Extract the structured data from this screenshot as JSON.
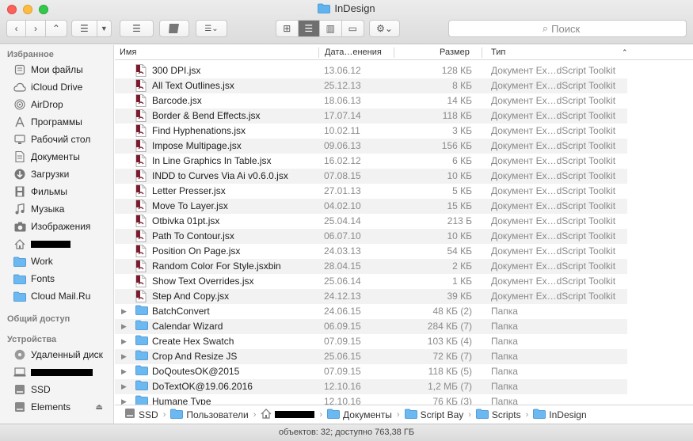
{
  "window": {
    "title": "InDesign"
  },
  "toolbar": {
    "search_placeholder": "Поиск"
  },
  "sidebar": {
    "favorites_label": "Избранное",
    "favorites": [
      {
        "label": "Мои файлы",
        "icon": "all-files-icon"
      },
      {
        "label": "iCloud Drive",
        "icon": "cloud-icon"
      },
      {
        "label": "AirDrop",
        "icon": "airdrop-icon"
      },
      {
        "label": "Программы",
        "icon": "applications-icon"
      },
      {
        "label": "Рабочий стол",
        "icon": "desktop-icon"
      },
      {
        "label": "Документы",
        "icon": "documents-icon"
      },
      {
        "label": "Загрузки",
        "icon": "downloads-icon"
      },
      {
        "label": "Фильмы",
        "icon": "movies-icon"
      },
      {
        "label": "Музыка",
        "icon": "music-icon"
      },
      {
        "label": "Изображения",
        "icon": "pictures-icon"
      },
      {
        "label": "",
        "icon": "home-icon"
      },
      {
        "label": "Work",
        "icon": "folder-icon"
      },
      {
        "label": "Fonts",
        "icon": "folder-icon"
      },
      {
        "label": "Cloud Mail.Ru",
        "icon": "folder-icon"
      }
    ],
    "shared_label": "Общий доступ",
    "devices_label": "Устройства",
    "devices": [
      {
        "label": "Удаленный диск",
        "icon": "optical-disc-icon"
      },
      {
        "label": "",
        "icon": "computer-icon"
      },
      {
        "label": "SSD",
        "icon": "drive-icon"
      },
      {
        "label": "Elements",
        "icon": "drive-icon"
      }
    ]
  },
  "columns": {
    "name": "Имя",
    "date": "Дата…енения",
    "size": "Размер",
    "kind": "Тип"
  },
  "files": [
    {
      "name": "300 DPI.jsx",
      "date": "13.06.12",
      "size": "128 КБ",
      "kind": "Документ Ex…dScript Toolkit",
      "type": "script"
    },
    {
      "name": "All Text Outlines.jsx",
      "date": "25.12.13",
      "size": "8 КБ",
      "kind": "Документ Ex…dScript Toolkit",
      "type": "script"
    },
    {
      "name": "Barcode.jsx",
      "date": "18.06.13",
      "size": "14 КБ",
      "kind": "Документ Ex…dScript Toolkit",
      "type": "script"
    },
    {
      "name": "Border & Bend Effects.jsx",
      "date": "17.07.14",
      "size": "118 КБ",
      "kind": "Документ Ex…dScript Toolkit",
      "type": "script"
    },
    {
      "name": "Find Hyphenations.jsx",
      "date": "10.02.11",
      "size": "3 КБ",
      "kind": "Документ Ex…dScript Toolkit",
      "type": "script"
    },
    {
      "name": "Impose Multipage.jsx",
      "date": "09.06.13",
      "size": "156 КБ",
      "kind": "Документ Ex…dScript Toolkit",
      "type": "script"
    },
    {
      "name": "In Line Graphics In Table.jsx",
      "date": "16.02.12",
      "size": "6 КБ",
      "kind": "Документ Ex…dScript Toolkit",
      "type": "script"
    },
    {
      "name": "INDD to Curves Via Ai v0.6.0.jsx",
      "date": "07.08.15",
      "size": "10 КБ",
      "kind": "Документ Ex…dScript Toolkit",
      "type": "script"
    },
    {
      "name": "Letter Presser.jsx",
      "date": "27.01.13",
      "size": "5 КБ",
      "kind": "Документ Ex…dScript Toolkit",
      "type": "script"
    },
    {
      "name": "Move To Layer.jsx",
      "date": "04.02.10",
      "size": "15 КБ",
      "kind": "Документ Ex…dScript Toolkit",
      "type": "script"
    },
    {
      "name": "Otbivka 01pt.jsx",
      "date": "25.04.14",
      "size": "213 Б",
      "kind": "Документ Ex…dScript Toolkit",
      "type": "script"
    },
    {
      "name": "Path To Contour.jsx",
      "date": "06.07.10",
      "size": "10 КБ",
      "kind": "Документ Ex…dScript Toolkit",
      "type": "script"
    },
    {
      "name": "Position On Page.jsx",
      "date": "24.03.13",
      "size": "54 КБ",
      "kind": "Документ Ex…dScript Toolkit",
      "type": "script"
    },
    {
      "name": "Random Color For Style.jsxbin",
      "date": "28.04.15",
      "size": "2 КБ",
      "kind": "Документ Ex…dScript Toolkit",
      "type": "script"
    },
    {
      "name": "Show Text Overrides.jsx",
      "date": "25.06.14",
      "size": "1 КБ",
      "kind": "Документ Ex…dScript Toolkit",
      "type": "script"
    },
    {
      "name": "Step And Copy.jsx",
      "date": "24.12.13",
      "size": "39 КБ",
      "kind": "Документ Ex…dScript Toolkit",
      "type": "script"
    },
    {
      "name": "BatchConvert",
      "date": "24.06.15",
      "size": "48 КБ (2)",
      "kind": "Папка",
      "type": "folder"
    },
    {
      "name": "Calendar Wizard",
      "date": "06.09.15",
      "size": "284 КБ (7)",
      "kind": "Папка",
      "type": "folder"
    },
    {
      "name": "Create Hex Swatch",
      "date": "07.09.15",
      "size": "103 КБ (4)",
      "kind": "Папка",
      "type": "folder"
    },
    {
      "name": "Crop And Resize JS",
      "date": "25.06.15",
      "size": "72 КБ (7)",
      "kind": "Папка",
      "type": "folder"
    },
    {
      "name": "DoQoutesOK@2015",
      "date": "07.09.15",
      "size": "118 КБ (5)",
      "kind": "Папка",
      "type": "folder"
    },
    {
      "name": "DoTextOK@19.06.2016",
      "date": "12.10.16",
      "size": "1,2 МБ (7)",
      "kind": "Папка",
      "type": "folder"
    },
    {
      "name": "Humane Type",
      "date": "12.10.16",
      "size": "76 КБ (3)",
      "kind": "Папка",
      "type": "folder"
    }
  ],
  "path": [
    {
      "label": "SSD",
      "icon": "drive-icon"
    },
    {
      "label": "Пользователи",
      "icon": "folder-icon"
    },
    {
      "label": "",
      "icon": "home-icon"
    },
    {
      "label": "Документы",
      "icon": "folder-icon"
    },
    {
      "label": "Script Bay",
      "icon": "folder-icon"
    },
    {
      "label": "Scripts",
      "icon": "folder-icon"
    },
    {
      "label": "InDesign",
      "icon": "folder-icon"
    }
  ],
  "status": {
    "text": "объектов: 32; доступно 763,38 ГБ"
  }
}
